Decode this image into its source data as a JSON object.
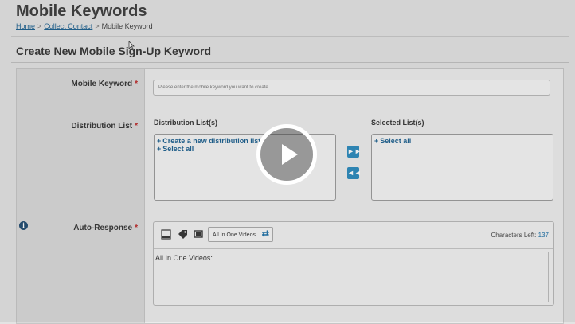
{
  "header": {
    "title": "Mobile Keywords",
    "breadcrumb": {
      "home": "Home",
      "separator": ">",
      "collect_contact": "Collect Contact",
      "current": "Mobile Keyword"
    }
  },
  "section": {
    "title": "Create New Mobile Sign-Up Keyword"
  },
  "form": {
    "mobile_keyword": {
      "label": "Mobile Keyword",
      "required_mark": "*",
      "placeholder": "Please enter the mobile keyword you want to create"
    },
    "distribution_list": {
      "label": "Distribution List",
      "required_mark": "*",
      "available_heading": "Distribution List(s)",
      "selected_heading": "Selected List(s)",
      "available_items": [
        {
          "plus": "+",
          "text": "Create a new distribution list"
        },
        {
          "plus": "+",
          "text": "Select all"
        }
      ],
      "selected_items": [
        {
          "plus": "+",
          "text": "Select all"
        }
      ],
      "add_icon": "double-right-arrow",
      "remove_icon": "double-left-arrow"
    },
    "auto_response": {
      "label": "Auto-Response",
      "required_mark": "*",
      "info_symbol": "i",
      "toolbar_icons": [
        "url-icon",
        "tag-icon",
        "message-icon"
      ],
      "select_value": "All In One Videos",
      "chars_left_label": "Characters Left:",
      "chars_left_value": "137",
      "message_text": "All In One Videos:"
    }
  },
  "video": {
    "play_icon": "play-icon"
  },
  "colors": {
    "accent": "#1a6fa6",
    "link": "#1a5f8f",
    "required": "#b22222",
    "button": "#2a89bd"
  }
}
